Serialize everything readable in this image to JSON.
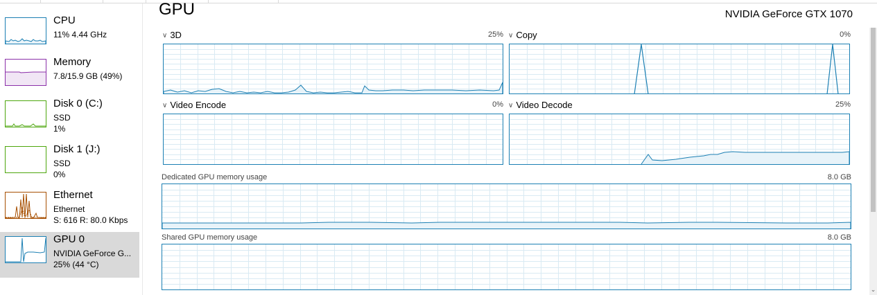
{
  "sidebar": {
    "items": [
      {
        "name": "CPU",
        "line1": "11%  4.44 GHz",
        "line2": "",
        "color": "#1b7fb3",
        "selected": false
      },
      {
        "name": "Memory",
        "line1": "7.8/15.9 GB (49%)",
        "line2": "",
        "color": "#8b2fa9",
        "selected": false
      },
      {
        "name": "Disk 0 (C:)",
        "line1": "SSD",
        "line2": "1%",
        "color": "#4da60c",
        "selected": false
      },
      {
        "name": "Disk 1 (J:)",
        "line1": "SSD",
        "line2": "0%",
        "color": "#4da60c",
        "selected": false
      },
      {
        "name": "Ethernet",
        "line1": "Ethernet",
        "line2": "S: 616  R: 80.0 Kbps",
        "color": "#a74f01",
        "selected": false
      },
      {
        "name": "GPU 0",
        "line1": "NVIDIA GeForce G...",
        "line2": "25%  (44 °C)",
        "color": "#1b7fb3",
        "selected": true
      }
    ]
  },
  "main": {
    "title": "GPU",
    "adapter": "NVIDIA GeForce GTX 1070",
    "engines": [
      {
        "label": "3D",
        "max": "25%"
      },
      {
        "label": "Copy",
        "max": "0%"
      },
      {
        "label": "Video Encode",
        "max": "0%"
      },
      {
        "label": "Video Decode",
        "max": "25%"
      }
    ],
    "dedicated": {
      "label": "Dedicated GPU memory usage",
      "max": "8.0 GB"
    },
    "shared": {
      "label": "Shared GPU memory usage",
      "max": "8.0 GB"
    }
  },
  "colors": {
    "accent": "#1b7fb3",
    "grid": "#d9eaf3",
    "selected_bg": "#d9d9d9"
  },
  "icons": {
    "chevron": "chevron-down-icon",
    "scroll_up": "scroll-up-arrow-icon",
    "scroll_down": "scroll-down-arrow-icon"
  }
}
